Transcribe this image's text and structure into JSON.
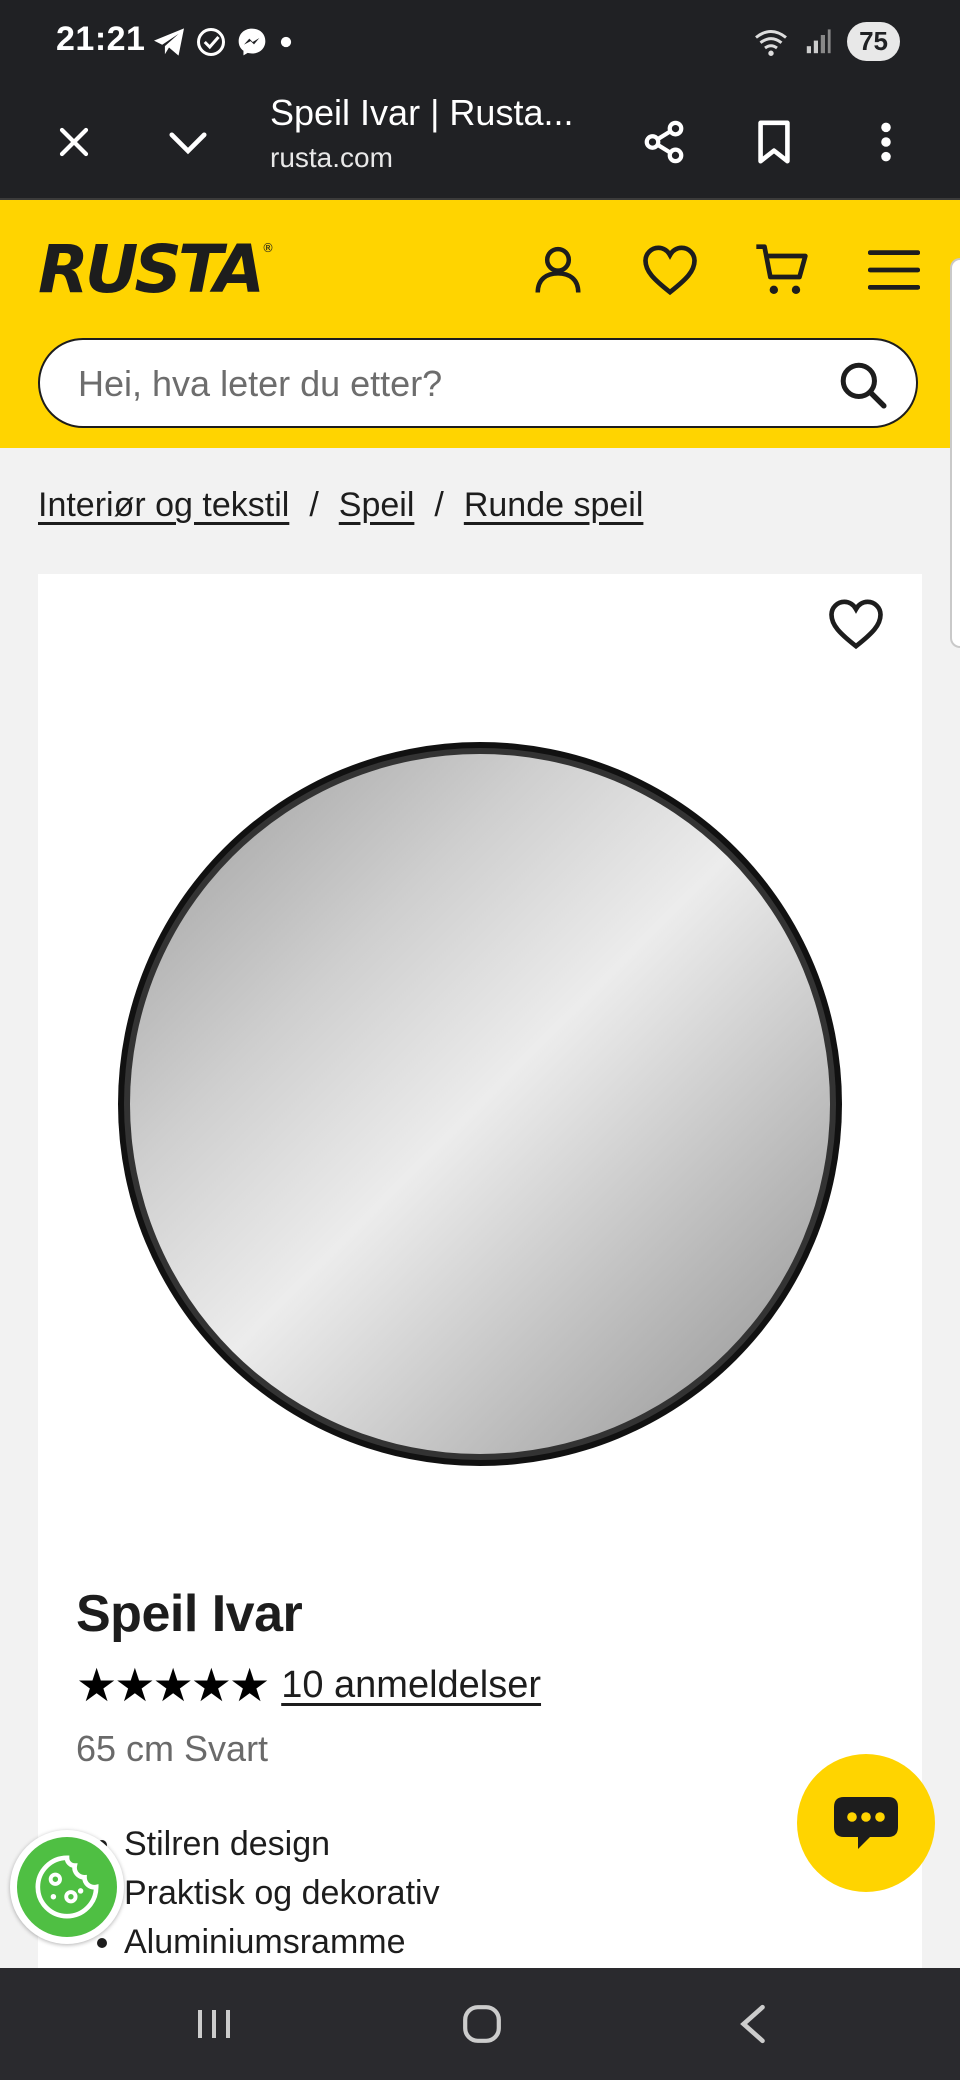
{
  "status_bar": {
    "time": "21:21",
    "battery": "75",
    "icons": [
      "telegram-icon",
      "check-circle-icon",
      "messenger-icon",
      "dot-icon",
      "wifi-icon",
      "signal-icon"
    ]
  },
  "browser": {
    "title": "Speil Ivar | Rusta...",
    "url": "rusta.com"
  },
  "header": {
    "logo": "RUSTA",
    "logo_mark": "®",
    "search_placeholder": "Hei, hva leter du etter?"
  },
  "breadcrumb": {
    "items": [
      "Interiør og tekstil",
      "Speil",
      "Runde speil"
    ],
    "separator": "/"
  },
  "product": {
    "title": "Speil Ivar",
    "stars": "★★★★★",
    "rating": 5,
    "reviews": "10 anmeldelser",
    "variant": "65 cm Svart",
    "features": [
      "Stilren design",
      "Praktisk og dekorativ",
      "Aluminiumsramme"
    ]
  },
  "colors": {
    "brand_yellow": "#ffd400",
    "dark": "#1d1d1d",
    "cookie_green": "#4fbf43"
  }
}
